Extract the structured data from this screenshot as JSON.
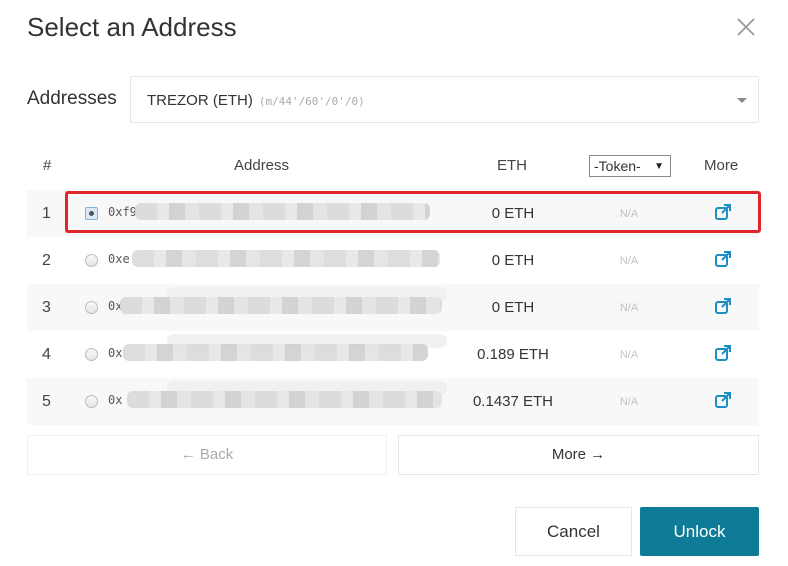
{
  "dialog": {
    "title": "Select an Address",
    "close_icon": "close-icon"
  },
  "addresses": {
    "label": "Addresses",
    "selected_wallet": "TREZOR (ETH)",
    "selected_path": "(m/44'/60'/0'/0)"
  },
  "table": {
    "headers": {
      "num": "#",
      "address": "Address",
      "eth": "ETH",
      "token_select": "-Token-",
      "more": "More"
    },
    "rows": [
      {
        "num": "1",
        "address": "0xf9",
        "eth": "0 ETH",
        "token": "N/A",
        "selected": true
      },
      {
        "num": "2",
        "address": "0xe",
        "eth": "0 ETH",
        "token": "N/A",
        "selected": false
      },
      {
        "num": "3",
        "address": "0x",
        "eth": "0 ETH",
        "token": "N/A",
        "selected": false
      },
      {
        "num": "4",
        "address": "0x",
        "eth": "0.189 ETH",
        "token": "N/A",
        "selected": false
      },
      {
        "num": "5",
        "address": "0x",
        "eth": "0.1437 ETH",
        "token": "N/A",
        "selected": false
      }
    ]
  },
  "pagination": {
    "back_label": "← Back",
    "more_label": "More →"
  },
  "footer": {
    "cancel_label": "Cancel",
    "unlock_label": "Unlock"
  },
  "colors": {
    "accent": "#0e7c96",
    "link_icon": "#1a8fc4",
    "highlight": "#e0262a"
  }
}
